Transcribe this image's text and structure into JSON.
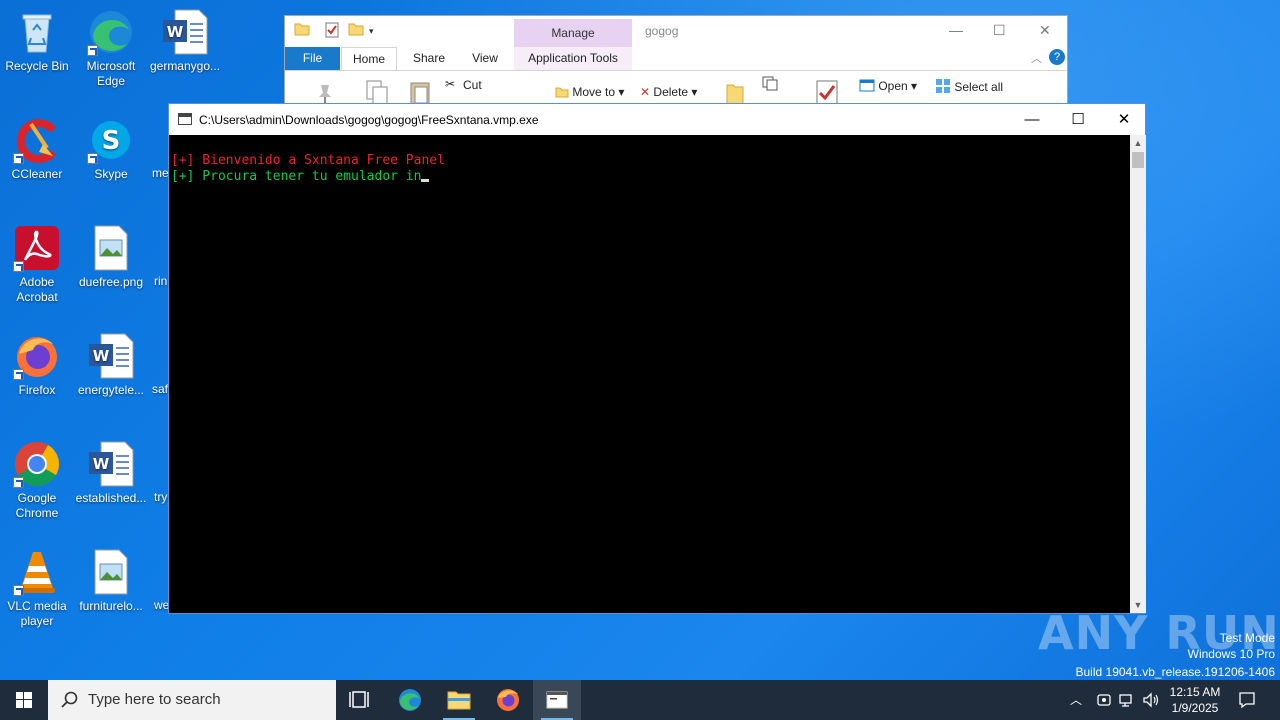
{
  "desktop": {
    "icons": [
      {
        "label": "Recycle Bin",
        "icon": "recycle-bin-icon"
      },
      {
        "label": "Microsoft Edge",
        "icon": "edge-icon"
      },
      {
        "label": "germanygo...",
        "icon": "word-doc-icon"
      },
      {
        "label": "CCleaner",
        "icon": "ccleaner-icon"
      },
      {
        "label": "Skype",
        "icon": "skype-icon"
      },
      {
        "label": "me",
        "icon": "partial-icon"
      },
      {
        "label": "Adobe Acrobat",
        "icon": "acrobat-icon"
      },
      {
        "label": "duefree.png",
        "icon": "image-file-icon"
      },
      {
        "label": "rin",
        "icon": "partial-icon"
      },
      {
        "label": "Firefox",
        "icon": "firefox-icon"
      },
      {
        "label": "energytele...",
        "icon": "word-doc-icon"
      },
      {
        "label": "saf",
        "icon": "partial-icon"
      },
      {
        "label": "Google Chrome",
        "icon": "chrome-icon"
      },
      {
        "label": "established...",
        "icon": "word-doc-icon"
      },
      {
        "label": "try",
        "icon": "partial-icon"
      },
      {
        "label": "VLC media player",
        "icon": "vlc-icon"
      },
      {
        "label": "furniturelo...",
        "icon": "image-file-icon"
      },
      {
        "label": "we",
        "icon": "partial-icon"
      }
    ]
  },
  "explorer": {
    "manage_tab": "Manage",
    "window_name": "gogog",
    "tabs": {
      "file": "File",
      "home": "Home",
      "share": "Share",
      "view": "View",
      "app_tools": "Application Tools"
    },
    "ribbon": {
      "cut": "Cut",
      "move_to": "Move to",
      "delete": "Delete",
      "open": "Open",
      "select_all": "Select all"
    }
  },
  "console": {
    "title": "C:\\Users\\admin\\Downloads\\gogog\\gogog\\FreeSxntana.vmp.exe",
    "lines": [
      "[+] Bienvenido a Sxntana Free Panel",
      "[+] Procura tener tu emulador in"
    ],
    "colors": {
      "line1": "#e8262a",
      "line2": "#13c74a"
    }
  },
  "watermark": {
    "text": "ANY RUN",
    "mode": "Test Mode",
    "os": "Windows 10 Pro",
    "build": "Build 19041.vb_release.191206-1406"
  },
  "taskbar": {
    "search_placeholder": "Type here to search",
    "time": "12:15 AM",
    "date": "1/9/2025"
  }
}
